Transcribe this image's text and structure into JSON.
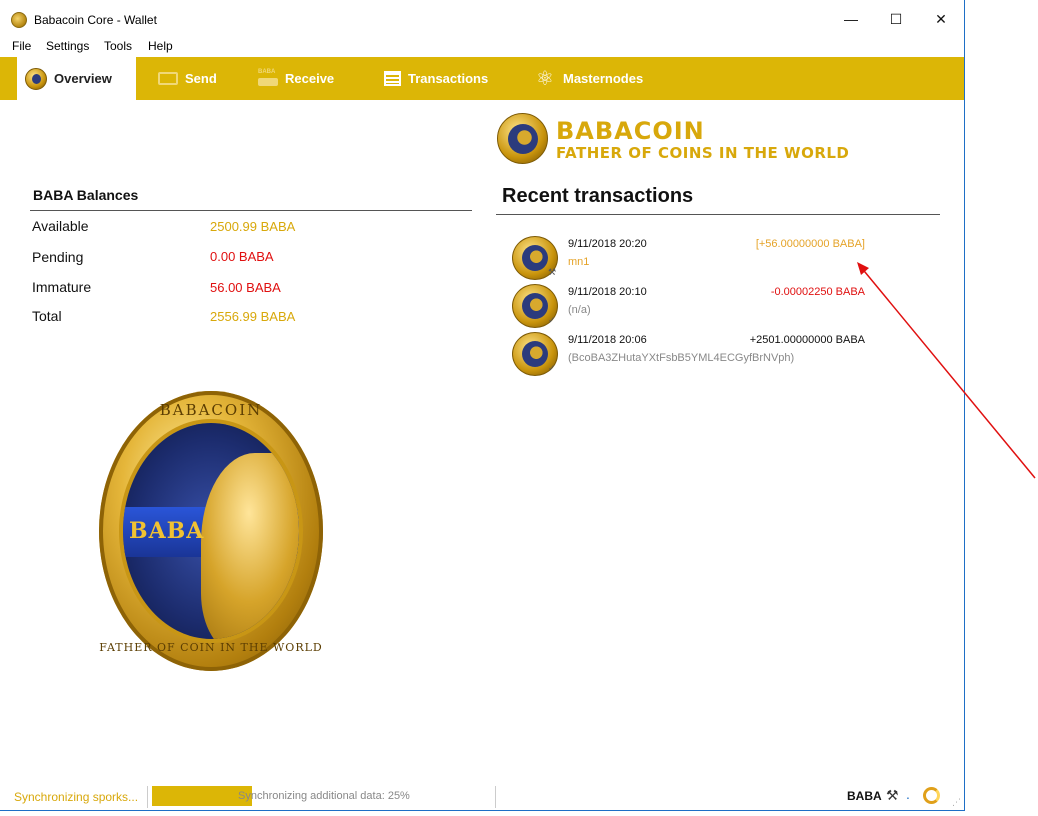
{
  "window": {
    "title": "Babacoin Core - Wallet",
    "minimize_glyph": "—",
    "maximize_glyph": "☐",
    "close_glyph": "✕",
    "background_hint": "babacoin_qt"
  },
  "menu": [
    "File",
    "Settings",
    "Tools",
    "Help"
  ],
  "tabs": [
    {
      "label": "Overview",
      "icon": "coin-icon",
      "active": true
    },
    {
      "label": "Send",
      "icon": "send-icon",
      "active": false
    },
    {
      "label": "Receive",
      "icon": "receive-icon",
      "active": false
    },
    {
      "label": "Transactions",
      "icon": "transactions-icon",
      "active": false
    },
    {
      "label": "Masternodes",
      "icon": "masternodes-icon",
      "active": false
    }
  ],
  "balances": {
    "title": "BABA Balances",
    "rows": [
      {
        "label": "Available",
        "value": "2500.99 BABA",
        "color": "#d8a80b"
      },
      {
        "label": "Pending",
        "value": "0.00 BABA",
        "color": "#e01010"
      },
      {
        "label": "Immature",
        "value": "56.00 BABA",
        "color": "#e01010"
      },
      {
        "label": "Total",
        "value": "2556.99 BABA",
        "color": "#d8a80b"
      }
    ]
  },
  "coin_art": {
    "top_text": "BABACOIN",
    "band_text": "BABA",
    "bottom_text": "FATHER OF COIN IN THE WORLD"
  },
  "logo": {
    "name": "BABACOIN",
    "tagline": "FATHER OF COINS IN THE WORLD"
  },
  "recent": {
    "title": "Recent transactions",
    "items": [
      {
        "date": "9/11/2018 20:20",
        "amount": "[+56.00000000 BABA]",
        "sub": "mn1",
        "amount_color": "#e5a328"
      },
      {
        "date": "9/11/2018 20:10",
        "amount": "-0.00002250 BABA",
        "sub": "(n/a)",
        "amount_color": "#e01010"
      },
      {
        "date": "9/11/2018 20:06",
        "amount": "+2501.00000000 BABA",
        "sub": " (BcoBA3ZHutaYXtFsbB5YML4ECGyfBrNVph)",
        "amount_color": "#111111"
      }
    ]
  },
  "status": {
    "sync_text": "Synchronizing sporks...",
    "progress_text": "Synchronizing additional data: 25%",
    "progress_fraction": 0.25,
    "unit": "BABA",
    "tools_glyph": "⚒",
    "network_dot": "."
  },
  "colors": {
    "accent": "#dcb606",
    "gold_text": "#d8a80b",
    "negative": "#e01010",
    "annotation_arrow": "#e01010"
  }
}
